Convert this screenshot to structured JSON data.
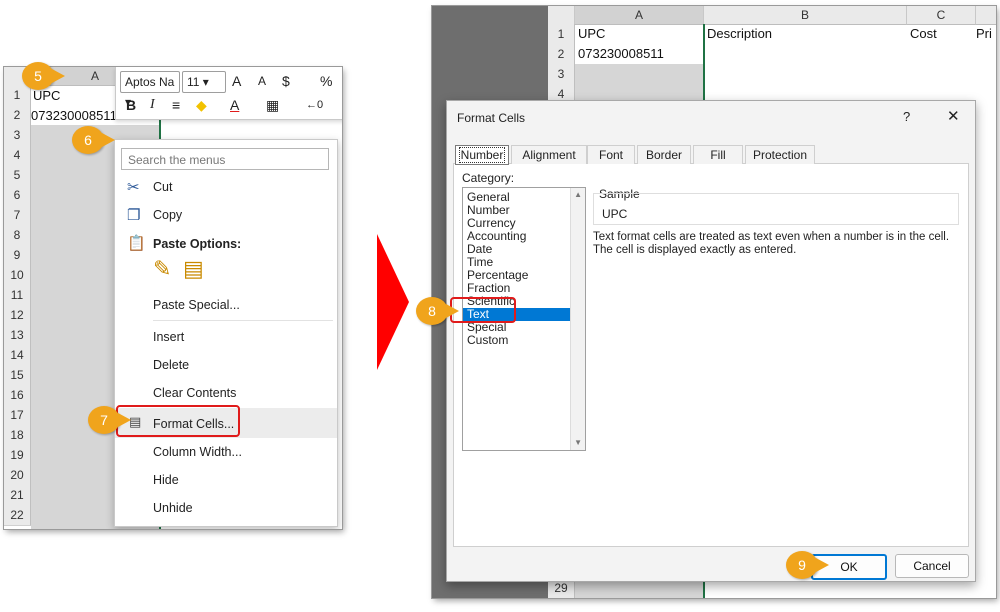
{
  "badges": {
    "b5": "5",
    "b6": "6",
    "b7": "7",
    "b8": "8",
    "b9": "9"
  },
  "left": {
    "col_a": "A",
    "rows": [
      "1",
      "2",
      "3",
      "4",
      "5",
      "6",
      "7",
      "8",
      "9",
      "10",
      "11",
      "12",
      "13",
      "14",
      "15",
      "16",
      "17",
      "18",
      "19",
      "20",
      "21",
      "22"
    ],
    "cell_a1": "UPC",
    "cell_a2": "073230008511",
    "toolbar": {
      "font_name": "Aptos Na",
      "font_size": "11",
      "grow": "A",
      "shrink": "A",
      "currency": "$",
      "percent": "%",
      "bold": "B",
      "italic": "I",
      "align": "≡",
      "fill": "◆",
      "fontcolor": "A",
      "borders": "▦",
      "dec": "←0"
    },
    "menu": {
      "search_placeholder": "Search the menus",
      "cut": "Cut",
      "copy": "Copy",
      "paste_options": "Paste Options:",
      "paste_special": "Paste Special...",
      "insert": "Insert",
      "delete": "Delete",
      "clear_contents": "Clear Contents",
      "format_cells": "Format Cells...",
      "column_width": "Column Width...",
      "hide": "Hide",
      "unhide": "Unhide"
    }
  },
  "right": {
    "cols": [
      "A",
      "B",
      "C"
    ],
    "headers": {
      "a": "UPC",
      "b": "Description",
      "c": "Cost",
      "d": "Pri"
    },
    "cell_a2": "073230008511",
    "rows": [
      "1",
      "2",
      "3",
      "4"
    ],
    "row_bottom": "29"
  },
  "dialog": {
    "title": "Format Cells",
    "help": "?",
    "close": "✕",
    "tabs": [
      "Number",
      "Alignment",
      "Font",
      "Border",
      "Fill",
      "Protection"
    ],
    "category_label": "Category:",
    "categories": [
      "General",
      "Number",
      "Currency",
      "Accounting",
      "Date",
      "Time",
      "Percentage",
      "Fraction",
      "Scientific",
      "Text",
      "Special",
      "Custom"
    ],
    "sample_label": "Sample",
    "sample_value": "UPC",
    "description": "Text format cells are treated as text even when a number is in the cell.",
    "description2": "The cell is displayed exactly as entered.",
    "ok": "OK",
    "cancel": "Cancel"
  },
  "colors": {
    "accent": "#0078d4",
    "badge": "#f0a41c",
    "highlight": "#e01b1b",
    "arrow": "#ff0000"
  }
}
